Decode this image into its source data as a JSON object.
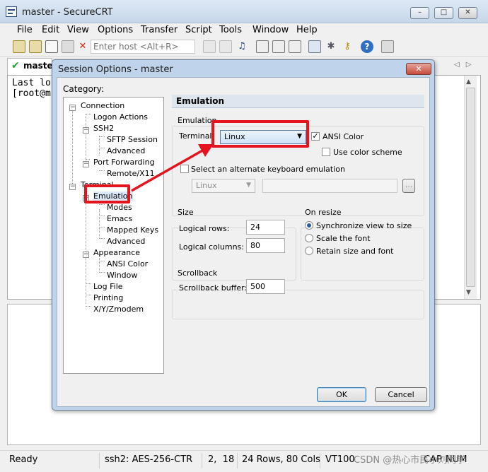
{
  "app": {
    "title": "master - SecureCRT",
    "window_buttons": [
      "–",
      "□",
      "✕"
    ]
  },
  "menu": [
    "File",
    "Edit",
    "View",
    "Options",
    "Transfer",
    "Script",
    "Tools",
    "Window",
    "Help"
  ],
  "toolbar": {
    "enter_host_placeholder": "Enter host <Alt+R>",
    "icons": [
      "connect-icon",
      "quick-connect-icon",
      "connect-tab-icon",
      "reconnect-icon",
      "disconnect-icon",
      "copy-icon",
      "paste-icon",
      "find-icon",
      "print-icon",
      "print-selection-icon",
      "print-setup-icon",
      "session-options-icon",
      "global-options-icon",
      "keymap-icon",
      "help-icon",
      "sftp-icon"
    ]
  },
  "tabs": {
    "session": "master",
    "arrows": "◁▷"
  },
  "terminal": {
    "lines": [
      "Last lo",
      "[root@m"
    ]
  },
  "status": {
    "ready": "Ready",
    "cipher": "ssh2: AES-256-CTR",
    "cursor": "2,  18",
    "size": "24 Rows, 80 Cols",
    "emulation": "VT100",
    "caps": "CAP",
    "num": "NUM"
  },
  "watermark": "CSDN @热心市民小刘同学",
  "dialog": {
    "title": "Session Options - master",
    "close": "✕",
    "category_label": "Category:",
    "tree": [
      {
        "label": "Connection"
      },
      {
        "label": "Logon Actions"
      },
      {
        "label": "SSH2"
      },
      {
        "label": "SFTP Session"
      },
      {
        "label": "Advanced"
      },
      {
        "label": "Port Forwarding"
      },
      {
        "label": "Remote/X11"
      },
      {
        "label": "Terminal"
      },
      {
        "label": "Emulation"
      },
      {
        "label": "Modes"
      },
      {
        "label": "Emacs"
      },
      {
        "label": "Mapped Keys"
      },
      {
        "label": "Advanced"
      },
      {
        "label": "Appearance"
      },
      {
        "label": "ANSI Color"
      },
      {
        "label": "Window"
      },
      {
        "label": "Log File"
      },
      {
        "label": "Printing"
      },
      {
        "label": "X/Y/Zmodem"
      }
    ],
    "panel_title": "Emulation",
    "emulation_group": {
      "label": "Emulation",
      "terminal_label": "Terminal:",
      "terminal_value": "Linux",
      "ansi_color": "ANSI Color",
      "ansi_color_checked": true,
      "use_color_scheme": "Use color scheme",
      "use_color_scheme_checked": false,
      "alt_keyboard": "Select an alternate keyboard emulation",
      "alt_keyboard_checked": false,
      "alt_keyboard_value": "Linux",
      "browse": "..."
    },
    "size_group": {
      "label": "Size",
      "rows_label": "Logical rows:",
      "rows_value": "24",
      "cols_label": "Logical columns:",
      "cols_value": "80"
    },
    "resize_group": {
      "label": "On resize",
      "options": [
        "Synchronize view to size",
        "Scale the font",
        "Retain size and font"
      ],
      "selected": "Synchronize view to size"
    },
    "scrollback_group": {
      "label": "Scrollback",
      "buffer_label": "Scrollback buffer:",
      "buffer_value": "500"
    },
    "ok": "OK",
    "cancel": "Cancel"
  },
  "annotation_color": "#e3141e"
}
